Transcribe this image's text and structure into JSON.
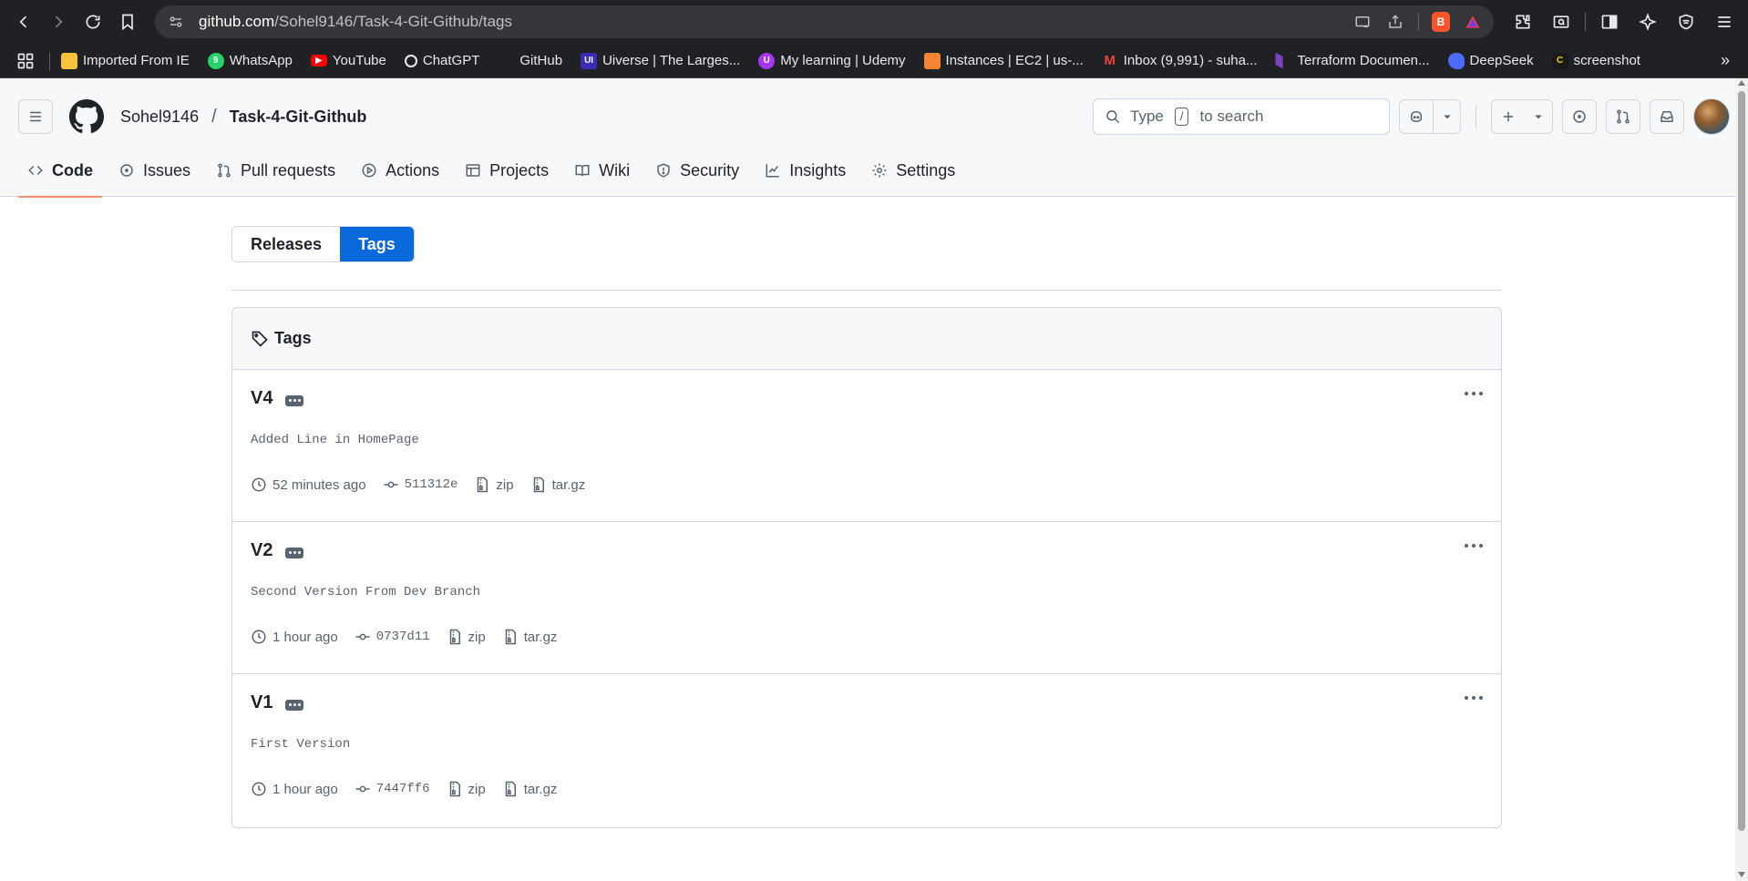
{
  "browser": {
    "url_host": "github.com",
    "url_path": "/Sohel9146/Task-4-Git-Github/tags",
    "bookmarks": [
      {
        "label": "Imported From IE",
        "icon": "folder-icon",
        "color": "#f9c23c"
      },
      {
        "label": "WhatsApp",
        "icon": "whatsapp-icon",
        "color": "#25d366"
      },
      {
        "label": "YouTube",
        "icon": "youtube-icon",
        "color": "#ff0000"
      },
      {
        "label": "ChatGPT",
        "icon": "chatgpt-icon",
        "color": "#202124"
      },
      {
        "label": "GitHub",
        "icon": "github-icon",
        "color": "#202124"
      },
      {
        "label": "Uiverse | The Larges...",
        "icon": "uiverse-icon",
        "color": "#3b2bb5"
      },
      {
        "label": "My learning | Udemy",
        "icon": "udemy-icon",
        "color": "#a435f0"
      },
      {
        "label": "Instances | EC2 | us-...",
        "icon": "aws-icon",
        "color": "#f58534"
      },
      {
        "label": "Inbox (9,991) - suha...",
        "icon": "gmail-icon",
        "color": "#ea4335"
      },
      {
        "label": "Terraform Documen...",
        "icon": "terraform-icon",
        "color": "#7b42bc"
      },
      {
        "label": "DeepSeek",
        "icon": "deepseek-icon",
        "color": "#4d6bfe"
      },
      {
        "label": "screenshot",
        "icon": "screenshot-icon",
        "color": "#1a1a1a"
      }
    ]
  },
  "header": {
    "owner": "Sohel9146",
    "repo": "Task-4-Git-Github",
    "search_prefix": "Type",
    "search_key": "/",
    "search_suffix": "to search"
  },
  "repo_nav": {
    "tabs": [
      {
        "label": "Code",
        "icon": "code-icon",
        "active": true
      },
      {
        "label": "Issues",
        "icon": "issue-opened-icon"
      },
      {
        "label": "Pull requests",
        "icon": "git-pull-request-icon"
      },
      {
        "label": "Actions",
        "icon": "play-icon"
      },
      {
        "label": "Projects",
        "icon": "table-icon"
      },
      {
        "label": "Wiki",
        "icon": "book-icon"
      },
      {
        "label": "Security",
        "icon": "shield-icon"
      },
      {
        "label": "Insights",
        "icon": "graph-icon"
      },
      {
        "label": "Settings",
        "icon": "gear-icon"
      }
    ]
  },
  "segmented": {
    "releases": "Releases",
    "tags": "Tags"
  },
  "tags_box": {
    "title": "Tags",
    "items": [
      {
        "name": "V4",
        "message": "Added Line in HomePage",
        "time": "52 minutes ago",
        "sha": "511312e",
        "zip": "zip",
        "targz": "tar.gz"
      },
      {
        "name": "V2",
        "message": "Second Version From Dev Branch",
        "time": "1 hour ago",
        "sha": "0737d11",
        "zip": "zip",
        "targz": "tar.gz"
      },
      {
        "name": "V1",
        "message": "First Version",
        "time": "1 hour ago",
        "sha": "7447ff6",
        "zip": "zip",
        "targz": "tar.gz"
      }
    ]
  },
  "colors": {
    "accent": "#0969da",
    "active_tab_underline": "#fd8c73",
    "browser_bg": "#202124"
  }
}
